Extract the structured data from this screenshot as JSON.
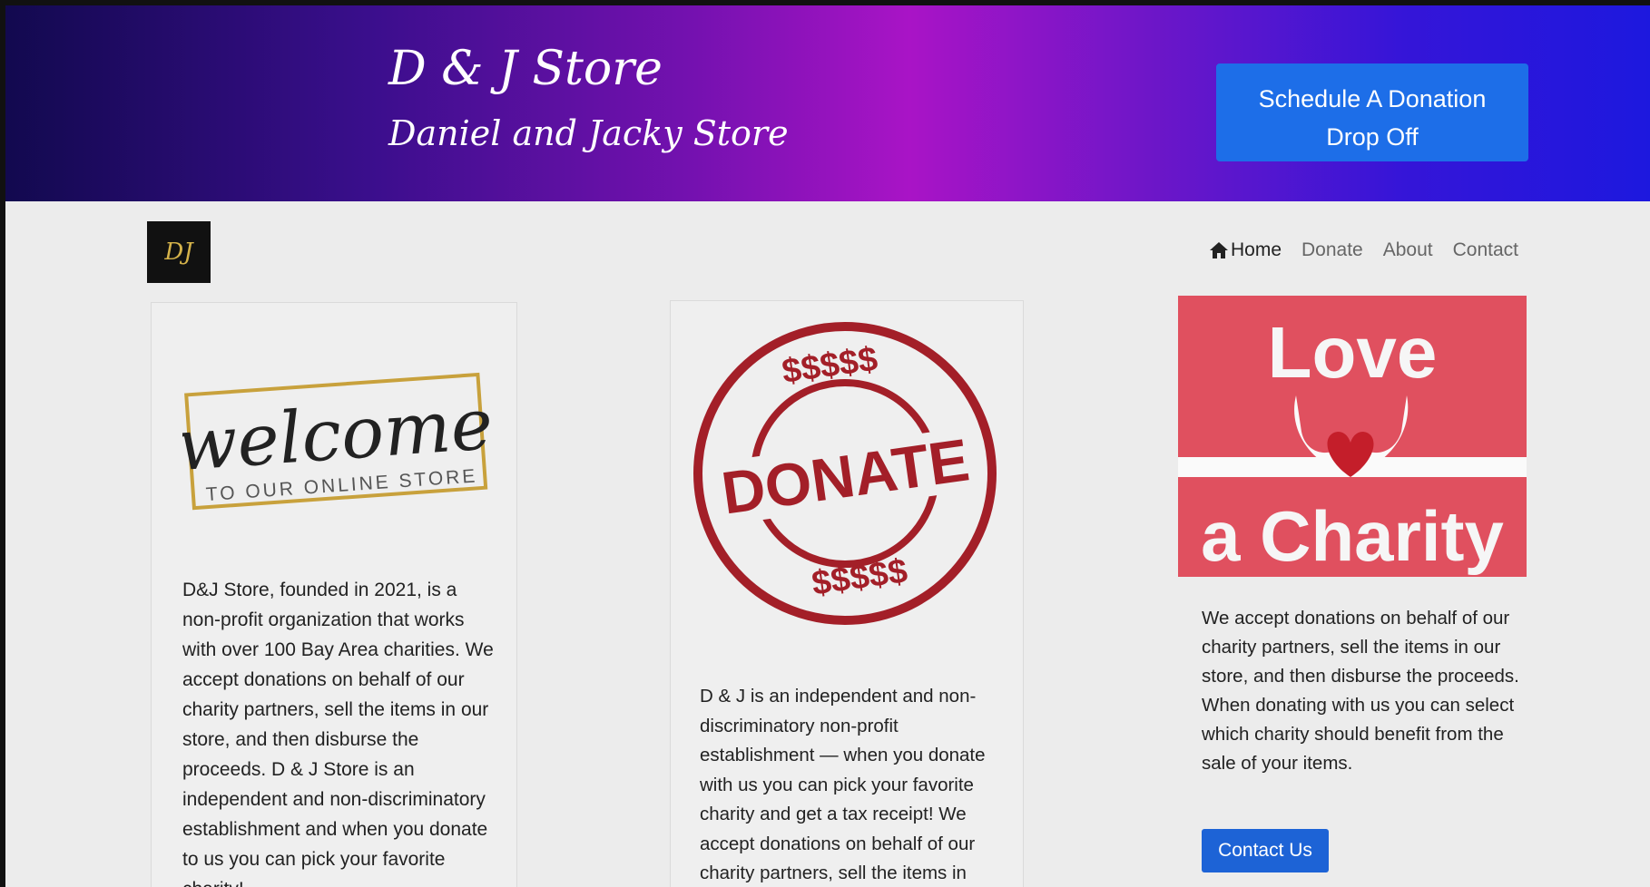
{
  "header": {
    "title": "D & J Store",
    "subtitle": "Daniel and Jacky Store",
    "cta_line1": "Schedule A Donation",
    "cta_line2": "Drop Off"
  },
  "logo": {
    "text": "DJ"
  },
  "nav": {
    "home": "Home",
    "donate": "Donate",
    "about": "About",
    "contact": "Contact"
  },
  "cards": {
    "welcome": {
      "image_script": "welcome",
      "image_caption": "TO OUR ONLINE STORE",
      "body": "D&J Store, founded in 2021, is a non-profit organization that works with over 100 Bay Area charities. We accept donations on behalf of our charity partners, sell the items in our store, and then disburse the proceeds. D & J Store is an independent and non-discriminatory establishment and when you donate to us you can pick your favorite charity!"
    },
    "donate": {
      "stamp_text": "DONATE",
      "stamp_top": "$$$$$",
      "stamp_bottom": "$$$$$",
      "body": "D & J is an independent and non-discriminatory non-profit establishment — when you donate with us you can pick your favorite charity and get a tax receipt! We accept donations on behalf of our charity partners, sell the items in"
    },
    "charity": {
      "image_top": "Love",
      "image_bottom": "a Charity",
      "body": "We accept donations on behalf of our charity partners, sell the items in our store, and then disburse the proceeds. When donating with us you can select which charity should benefit from the sale of your items.",
      "button": "Contact Us"
    }
  },
  "colors": {
    "cta": "#1d6ee8",
    "stamp": "#a31f28",
    "charity_bg": "#e0505f"
  }
}
